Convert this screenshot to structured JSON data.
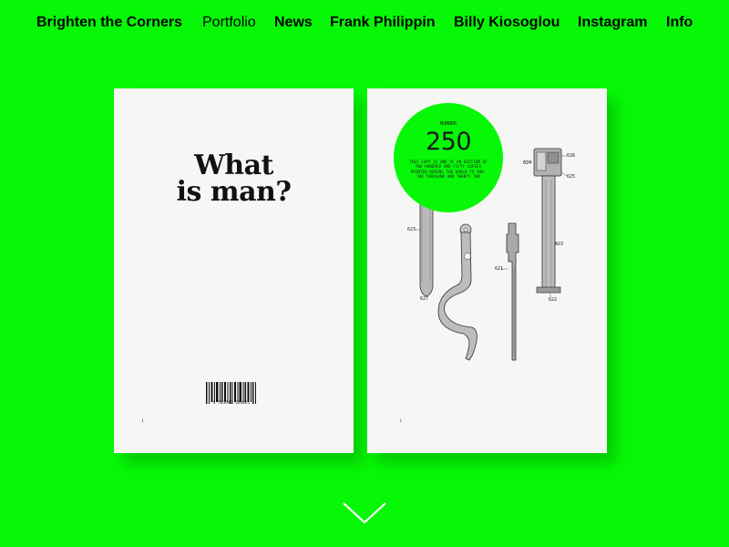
{
  "nav": {
    "items": [
      {
        "label": "Brighten the Corners"
      },
      {
        "label": "Portfolio"
      },
      {
        "label": "News"
      },
      {
        "label": "Frank Philippin"
      },
      {
        "label": "Billy Kiosoglou"
      },
      {
        "label": "Instagram"
      },
      {
        "label": "Info"
      }
    ]
  },
  "book": {
    "title_line1": "What",
    "title_line2": "is man?",
    "barcode_number": "9 783949 363061",
    "left_folio": "1",
    "right_folio": "i"
  },
  "edition_badge": {
    "label": "NUMBER",
    "number": "250",
    "text": "THIS COPY IS ONE OF AN EDITION OF TWO HUNDRED AND FIFTY COPIES PRINTED DURING THE WORLD TO ADD. TWO THOUSAND AND TWENTY TWO"
  },
  "drawing_labels": [
    "624",
    "626",
    "625",
    "623",
    "621",
    "627",
    "623",
    "622"
  ],
  "colors": {
    "background": "#06f806",
    "text": "#000000",
    "page": "#f6f6f4"
  },
  "icons": {
    "scroll": "chevron-down-icon"
  }
}
